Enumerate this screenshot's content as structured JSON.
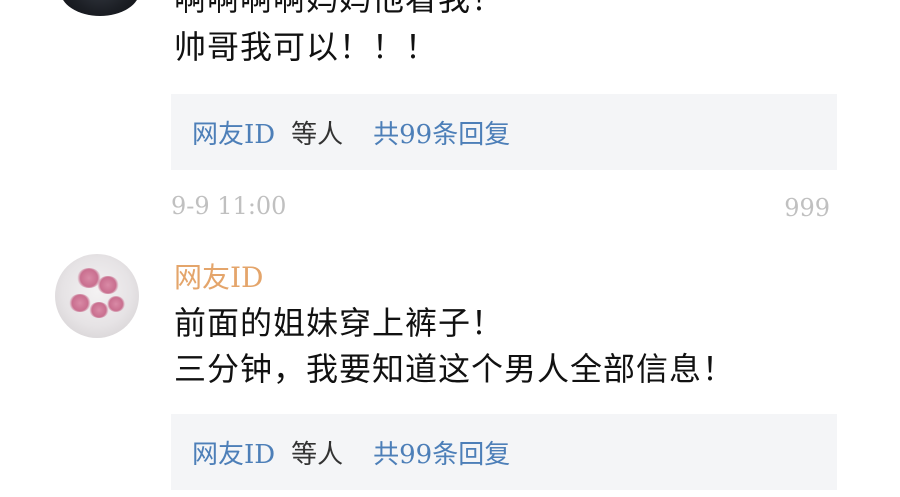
{
  "comment_prev": {
    "text_lines": [
      "啊啊啊啊妈妈他看我！",
      "帅哥我可以！！！"
    ],
    "reply_summary": {
      "user": "网友ID",
      "etc": "等人",
      "count_label": "共99条回复"
    },
    "time": "9-9 11:00",
    "likes": "999"
  },
  "comment_next": {
    "username": "网友ID",
    "text_lines": [
      "前面的姐妹穿上裤子！",
      "三分钟，我要知道这个男人全部信息！"
    ],
    "reply_summary": {
      "user": "网友ID",
      "etc": "等人",
      "count_label": "共99条回复"
    }
  },
  "colors": {
    "username": "#e4a56b",
    "link_blue": "#4d7fb8",
    "meta_gray": "#c0c0c0",
    "reply_bg": "#f4f5f7"
  }
}
